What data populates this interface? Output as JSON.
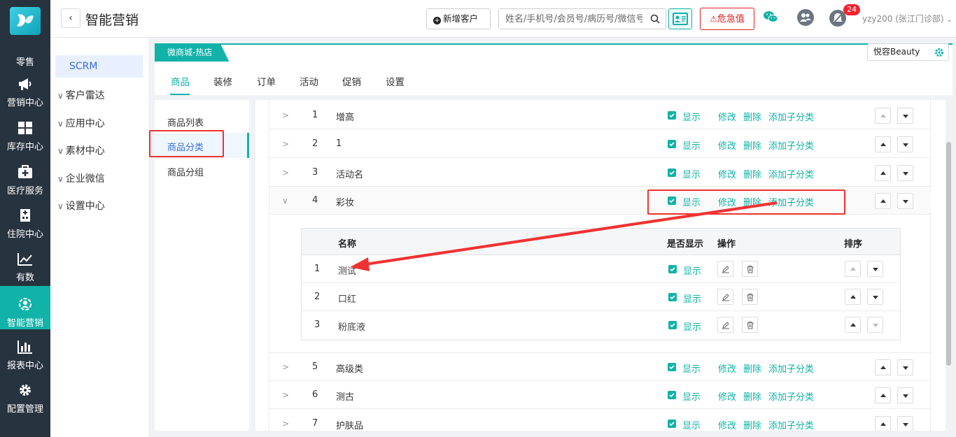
{
  "nav": {
    "items": [
      {
        "label": "零售",
        "icon": "retail-icon"
      },
      {
        "label": "营销中心",
        "icon": "megaphone-icon"
      },
      {
        "label": "库存中心",
        "icon": "grid-icon"
      },
      {
        "label": "医疗服务",
        "icon": "medical-kit-icon"
      },
      {
        "label": "住院中心",
        "icon": "hospital-icon"
      },
      {
        "label": "有数",
        "icon": "trend-chart-icon"
      },
      {
        "label": "智能营销",
        "icon": "smart-marketing-icon"
      },
      {
        "label": "报表中心",
        "icon": "bar-chart-icon"
      },
      {
        "label": "配置管理",
        "icon": "gear-icon"
      }
    ],
    "active": "智能营销"
  },
  "header": {
    "back": "‹",
    "title": "智能营销",
    "add_customer": "新增客户",
    "search_placeholder": "姓名/手机号/会员号/病历号/微信号",
    "danger": "危急值",
    "notification_count": "24",
    "user": "yzy200 (张江门诊部)"
  },
  "menu": {
    "scrm": "SCRM",
    "items": [
      "客户雷达",
      "应用中心",
      "素材中心",
      "企业微信",
      "设置中心"
    ]
  },
  "shop": {
    "store_tab": "微商城-热店",
    "brand": "悦容Beauty",
    "tabs": [
      "商品",
      "装修",
      "订单",
      "活动",
      "促销",
      "设置"
    ],
    "active_tab": "商品"
  },
  "submenu": {
    "items": [
      "商品列表",
      "商品分类",
      "商品分组"
    ],
    "active": "商品分类"
  },
  "labels": {
    "show": "显示",
    "edit": "修改",
    "delete": "删除",
    "add_sub": "添加子分类"
  },
  "categories": [
    {
      "no": "1",
      "name": "增高"
    },
    {
      "no": "2",
      "name": "1"
    },
    {
      "no": "3",
      "name": "活动名"
    },
    {
      "no": "4",
      "name": "彩妆",
      "expanded": true
    },
    {
      "no": "5",
      "name": "高级类"
    },
    {
      "no": "6",
      "name": "测古"
    },
    {
      "no": "7",
      "name": "护肤品"
    }
  ],
  "subtable": {
    "headers": {
      "name": "名称",
      "visible": "是否显示",
      "ops": "操作",
      "sort": "排序"
    },
    "rows": [
      {
        "no": "1",
        "name": "测试"
      },
      {
        "no": "2",
        "name": "口红"
      },
      {
        "no": "3",
        "name": "粉底液"
      }
    ]
  },
  "colors": {
    "accent": "#11b2a8",
    "annotation": "#f03232",
    "sidebar": "#283340"
  }
}
